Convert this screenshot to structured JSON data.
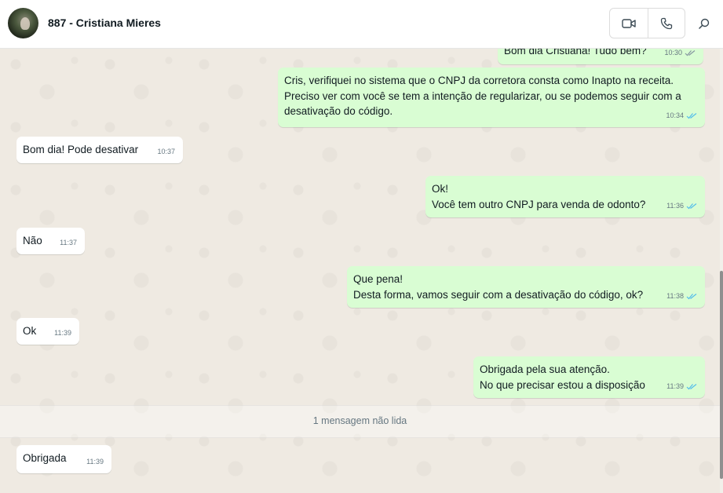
{
  "header": {
    "title": "887 - Cristiana Mieres",
    "video_icon": "video-camera-icon",
    "call_icon": "phone-icon",
    "search_icon": "search-icon"
  },
  "colors": {
    "outgoing_bubble": "#d9fdd3",
    "incoming_bubble": "#ffffff",
    "read_ticks": "#53bdeb",
    "sent_ticks": "#8696a0",
    "chat_background": "#efeae2"
  },
  "messages": [
    {
      "direction": "out",
      "text": "Bom dia Cristiana! Tudo bem?",
      "time": "10:30",
      "status": "delivered"
    },
    {
      "direction": "out",
      "text": "Cris, verifiquei no sistema que o CNPJ da corretora consta como Inapto na receita.\nPreciso ver com você se tem a intenção de regularizar, ou se podemos seguir com a desativação do código.",
      "time": "10:34",
      "status": "read"
    },
    {
      "direction": "in",
      "text": "Bom dia! Pode desativar",
      "time": "10:37"
    },
    {
      "direction": "out",
      "text": "Ok!\nVocê tem outro CNPJ para venda de odonto?",
      "time": "11:36",
      "status": "read"
    },
    {
      "direction": "in",
      "text": "Não",
      "time": "11:37"
    },
    {
      "direction": "out",
      "text": "Que pena!\nDesta forma, vamos seguir com a desativação do código, ok?",
      "time": "11:38",
      "status": "read"
    },
    {
      "direction": "in",
      "text": "Ok",
      "time": "11:39"
    },
    {
      "direction": "out",
      "text": "Obrigada pela sua atenção.\nNo que precisar estou a disposição",
      "time": "11:39",
      "status": "read"
    }
  ],
  "unread_divider": "1 mensagem não lida",
  "unread_messages": [
    {
      "direction": "in",
      "text": "Obrigada",
      "time": "11:39"
    }
  ]
}
